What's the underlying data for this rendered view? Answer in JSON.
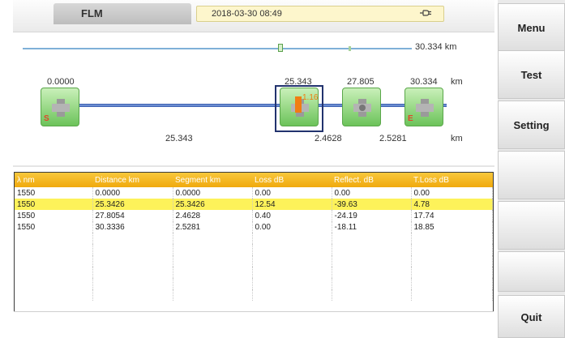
{
  "header": {
    "title": "FLM",
    "datetime": "2018-03-30 08:49",
    "plug_icon": "power-plug-icon"
  },
  "graph": {
    "total_length": "30.334 km",
    "positions": [
      "0.0000",
      "25.343",
      "27.805",
      "30.334"
    ],
    "position_unit": "km",
    "segments": [
      "25.343",
      "2.4628",
      "2.5281"
    ],
    "segment_unit": "km",
    "selected_loss": "1.16",
    "start_letter": "S",
    "end_letter": "E",
    "event_icon": "splice-event-icon",
    "colors": {
      "event_green": "#6cc35a",
      "fiber_blue": "#2c4fa3",
      "loss_orange": "#f07d12",
      "selection_navy": "#22336e"
    }
  },
  "table": {
    "columns": [
      "λ nm",
      "Distance km",
      "Segment km",
      "Loss dB",
      "Reflect. dB",
      "T.Loss dB"
    ],
    "rows": [
      [
        "1550",
        "0.0000",
        "0.0000",
        "0.00",
        "0.00",
        "0.00"
      ],
      [
        "1550",
        "25.3426",
        "25.3426",
        "12.54",
        "-39.63",
        "4.78"
      ],
      [
        "1550",
        "27.8054",
        "2.4628",
        "0.40",
        "-24.19",
        "17.74"
      ],
      [
        "1550",
        "30.3336",
        "2.5281",
        "0.00",
        "-18.11",
        "18.85"
      ]
    ],
    "selected_row": 1,
    "header_color": "#f0a90d",
    "highlight_color": "#fdf25a"
  },
  "sidebar": {
    "buttons": [
      "Menu",
      "Test",
      "Setting",
      "",
      "",
      "",
      "Quit"
    ]
  }
}
